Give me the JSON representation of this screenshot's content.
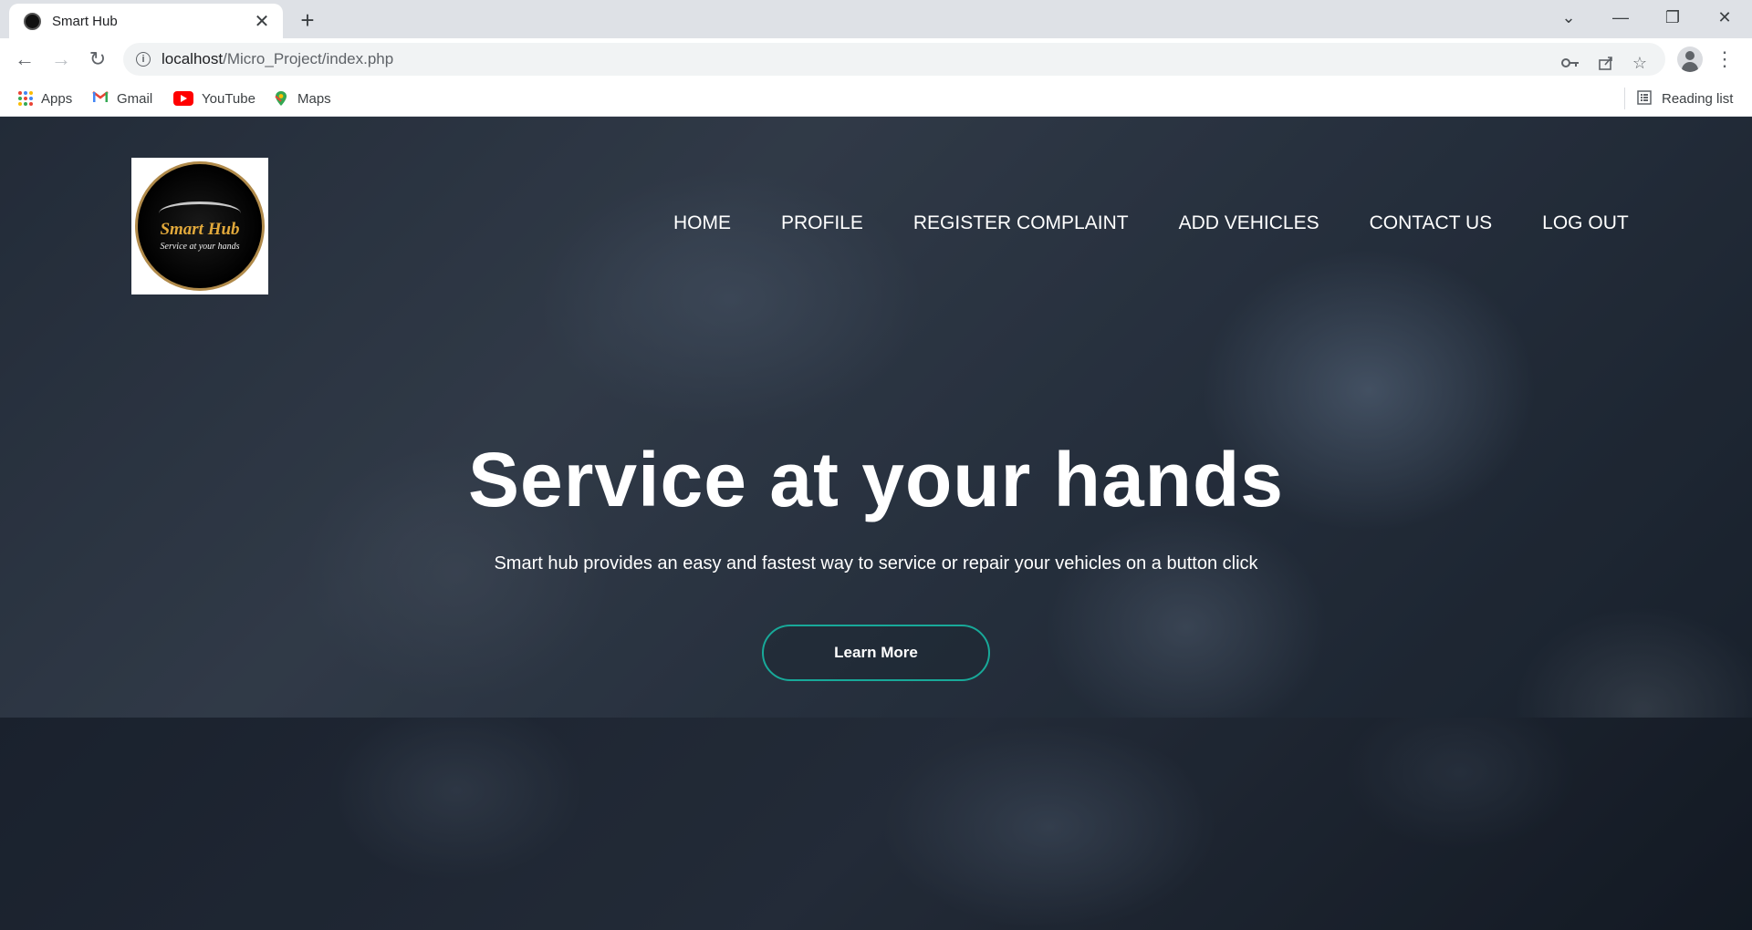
{
  "browser": {
    "tab_title": "Smart Hub",
    "tab_close": "✕",
    "new_tab": "+",
    "window_controls": {
      "tab_search": "⌄",
      "minimize": "—",
      "restore": "❐",
      "close": "✕"
    },
    "nav": {
      "back": "←",
      "forward": "→",
      "reload": "↻"
    },
    "url_host": "localhost",
    "url_path": "/Micro_Project/index.php",
    "icons": [
      "info-icon",
      "key-icon",
      "share-icon",
      "star-icon",
      "profile-icon",
      "menu-icon"
    ],
    "bookmarks": [
      {
        "label": "Apps",
        "icon": "apps-icon"
      },
      {
        "label": "Gmail",
        "icon": "gmail-icon"
      },
      {
        "label": "YouTube",
        "icon": "youtube-icon"
      },
      {
        "label": "Maps",
        "icon": "maps-icon"
      }
    ],
    "reading_list": "Reading list"
  },
  "site": {
    "logo": {
      "brand": "Smart Hub",
      "tagline": "Service at your hands"
    },
    "menu": [
      "HOME",
      "PROFILE",
      "REGISTER COMPLAINT",
      "ADD VEHICLES",
      "CONTACT US",
      "LOG OUT"
    ],
    "hero": {
      "title": "Service at your hands",
      "subtitle": "Smart hub provides an easy and fastest way to service or repair your vehicles on a button click",
      "cta_label": "Learn More"
    },
    "colors": {
      "accent": "#18a999",
      "logo_gold": "#e2a93b"
    }
  }
}
